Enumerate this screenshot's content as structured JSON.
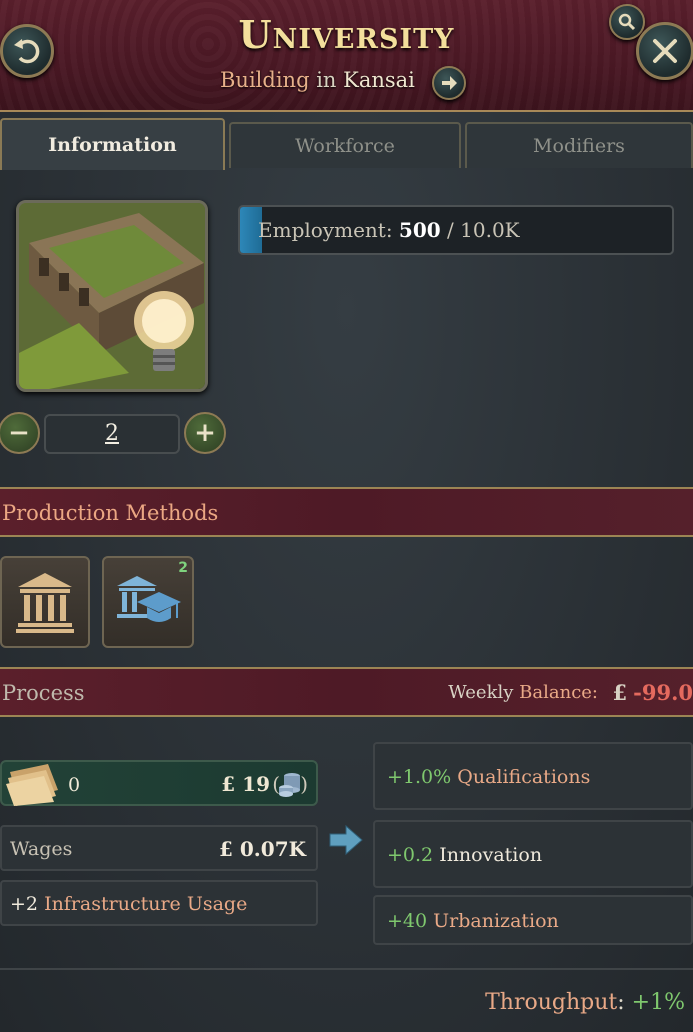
{
  "header": {
    "title": "University",
    "subtitle_type": "Building",
    "subtitle_in": "in",
    "subtitle_location": "Kansai"
  },
  "tabs": [
    {
      "label": "Information",
      "active": true
    },
    {
      "label": "Workforce",
      "active": false
    },
    {
      "label": "Modifiers",
      "active": false
    }
  ],
  "employment": {
    "label": "Employment:",
    "current": "500",
    "separator": "/",
    "max": "10.0K",
    "fill_fraction": 0.05
  },
  "level": {
    "value": "2"
  },
  "production_methods": {
    "title": "Production Methods",
    "items": [
      {
        "icon": "building-columns-icon",
        "badge": ""
      },
      {
        "icon": "education-institution-icon",
        "badge": "2"
      }
    ]
  },
  "process": {
    "title": "Process",
    "weekly_label_1": "Weekly",
    "weekly_label_2": "Balance:",
    "currency": "£",
    "weekly_value": "-99.0",
    "input": {
      "icon": "paper-goods-icon",
      "quantity": "0",
      "price": "£ 19",
      "paren_open": "(",
      "paren_close": ")",
      "price_icon": "coins-icon"
    },
    "wages": {
      "label": "Wages",
      "value": "£ 0.07K"
    },
    "infrastructure": {
      "amount": "+2",
      "label": "Infrastructure Usage"
    },
    "outputs": [
      {
        "amount": "+1.0%",
        "label": "Qualifications"
      },
      {
        "amount": "+0.2",
        "label": "Innovation"
      },
      {
        "amount": "+40",
        "label": "Urbanization"
      }
    ]
  },
  "throughput": {
    "label": "Throughput",
    "colon": ":",
    "value": "+1%"
  },
  "colors": {
    "header_bg": "#4a1824",
    "accent_gold": "#f3df9c",
    "positive": "#7fc86e",
    "negative": "#e46a5e",
    "highlight": "#e9a987"
  }
}
